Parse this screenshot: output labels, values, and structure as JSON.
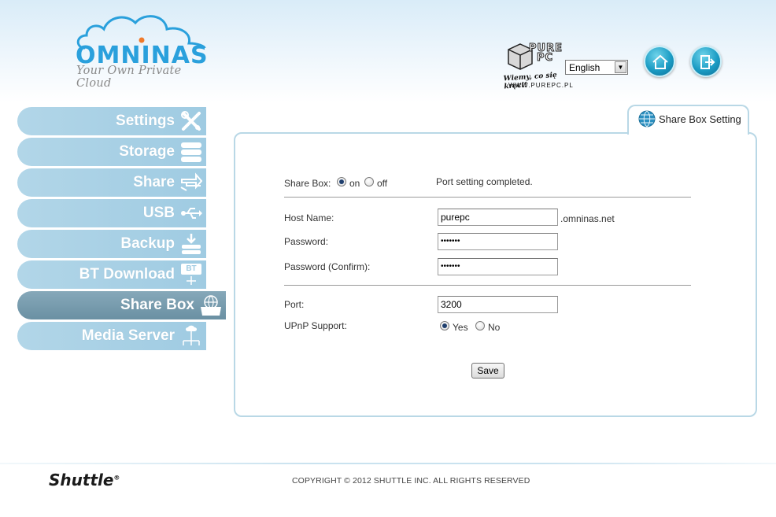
{
  "header": {
    "logo_name": "OMNINAS",
    "logo_tagline": "Your Own Private Cloud",
    "purepc_word1": "PURE",
    "purepc_word2": "PC",
    "purepc_slogan": "Wiemy, co się kręci!",
    "purepc_url": "WWW.PUREPC.PL",
    "language": "English",
    "home_icon": "home-icon",
    "logout_icon": "logout-icon"
  },
  "sidebar": {
    "items": [
      {
        "label": "Settings",
        "icon": "tools-icon"
      },
      {
        "label": "Storage",
        "icon": "storage-icon"
      },
      {
        "label": "Share",
        "icon": "share-icon"
      },
      {
        "label": "USB",
        "icon": "usb-icon"
      },
      {
        "label": "Backup",
        "icon": "backup-icon"
      },
      {
        "label": "BT Download",
        "icon": "bt-icon",
        "badge": "BT"
      },
      {
        "label": "Share Box",
        "icon": "globe-box-icon"
      },
      {
        "label": "Media Server",
        "icon": "media-server-icon"
      }
    ],
    "active_index": 6
  },
  "panel": {
    "tab_label": "Share Box Setting",
    "share_box_label": "Share Box:",
    "share_box_on": "on",
    "share_box_off": "off",
    "share_box_value": "on",
    "status_message": "Port setting completed.",
    "host_name_label": "Host Name:",
    "host_name_value": "purepc",
    "host_suffix": ".omninas.net",
    "password_label": "Password:",
    "password_value": "•••••••",
    "password_confirm_label": "Password (Confirm):",
    "password_confirm_value": "•••••••",
    "port_label": "Port:",
    "port_value": "3200",
    "upnp_label": "UPnP Support:",
    "upnp_yes": "Yes",
    "upnp_no": "No",
    "upnp_value": "Yes",
    "save_label": "Save"
  },
  "footer": {
    "brand": "Shuttle",
    "brand_mark": "®",
    "copyright": "COPYRIGHT © 2012 SHUTTLE INC. ALL RIGHTS RESERVED"
  },
  "colors": {
    "accent": "#2aa0dc",
    "nav_bg": "#a8d1e5",
    "nav_active": "#7599ab",
    "panel_border": "#b9d8e6"
  }
}
